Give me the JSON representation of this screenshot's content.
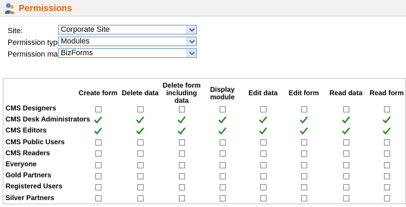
{
  "header": {
    "title": "Permissions",
    "icon": "users-permissions-icon"
  },
  "form": {
    "site": {
      "label": "Site:",
      "value": "Corporate Site"
    },
    "permission_type": {
      "label": "Permission type:",
      "value": "Modules"
    },
    "permission_matrix": {
      "label": "Permission matrix:",
      "value": "BizForms"
    }
  },
  "matrix": {
    "columns": [
      "Create form",
      "Delete data",
      "Delete form including data",
      "Display module",
      "Edit data",
      "Edit form",
      "Read data",
      "Read form"
    ],
    "rows": [
      {
        "label": "CMS Designers",
        "values": [
          false,
          false,
          false,
          false,
          false,
          false,
          false,
          false
        ]
      },
      {
        "label": "CMS Desk Administrators",
        "values": [
          true,
          true,
          true,
          true,
          true,
          true,
          true,
          true
        ]
      },
      {
        "label": "CMS Editors",
        "values": [
          true,
          true,
          true,
          true,
          true,
          true,
          true,
          true
        ]
      },
      {
        "label": "CMS Public Users",
        "values": [
          false,
          false,
          false,
          false,
          false,
          false,
          false,
          false
        ]
      },
      {
        "label": "CMS Readers",
        "values": [
          false,
          false,
          false,
          false,
          false,
          false,
          false,
          false
        ]
      },
      {
        "label": "Everyone",
        "values": [
          false,
          false,
          false,
          false,
          false,
          false,
          false,
          false
        ]
      },
      {
        "label": "Gold Partners",
        "values": [
          false,
          false,
          false,
          false,
          false,
          false,
          false,
          false
        ]
      },
      {
        "label": "Registered Users",
        "values": [
          false,
          false,
          false,
          false,
          false,
          false,
          false,
          false
        ]
      },
      {
        "label": "Silver Partners",
        "values": [
          false,
          false,
          false,
          false,
          false,
          false,
          false,
          false
        ]
      }
    ]
  },
  "colors": {
    "title": "#e8620a",
    "check": "#2e8b2e",
    "border": "#c8c8c8"
  }
}
